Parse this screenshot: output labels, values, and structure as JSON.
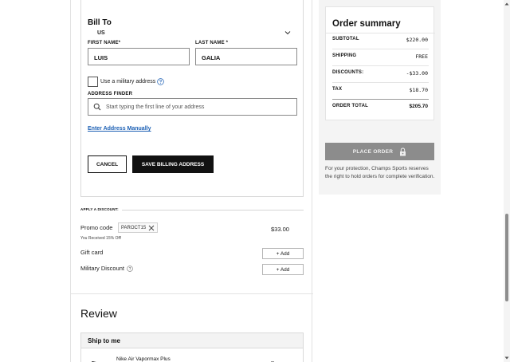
{
  "billing": {
    "title": "Bill To",
    "country": "US",
    "first_name_label": "FIRST NAME*",
    "first_name_value": "LUIS",
    "last_name_label": "LAST NAME *",
    "last_name_value": "GALIA",
    "military_checkbox_label": "Use a military address",
    "military_checked": false,
    "address_finder_label": "ADDRESS FINDER",
    "address_finder_placeholder": "Start typing the first line of your address",
    "enter_manually_link": "Enter Address Manually",
    "cancel_label": "CANCEL",
    "save_label": "SAVE BILLING ADDRESS"
  },
  "discounts": {
    "heading": "APPLY A DISCOUNT:",
    "promo_label": "Promo code",
    "promo_code": "PAROCT15",
    "promo_amount": "$33.00",
    "promo_received": "You Received 15% Off!",
    "gift_card_label": "Gift card",
    "gift_card_add": "+ Add",
    "military_discount_label": "Military Discount",
    "military_discount_add": "+ Add"
  },
  "review": {
    "title": "Review",
    "ship_header": "Ship to me",
    "product_name": "Nike Air Vapormax Plus"
  },
  "summary": {
    "title": "Order summary",
    "subtotal_label": "SUBTOTAL",
    "subtotal_value": "$220.00",
    "shipping_label": "SHIPPING",
    "shipping_value": "FREE",
    "discounts_label": "DISCOUNTS:",
    "discounts_value": "-$33.00",
    "tax_label": "TAX",
    "tax_value": "$18.70",
    "total_label": "ORDER TOTAL",
    "total_value": "$205.70",
    "place_order_label": "PLACE ORDER",
    "protection_note": "For your protection, Champs Sports reserves the right to hold orders for complete verification."
  },
  "icons": {
    "chevron": "chevron-down-icon",
    "help": "help-circle-icon",
    "search": "search-icon",
    "close": "close-icon",
    "lock": "lock-icon"
  },
  "colors": {
    "primary_button": "#111111",
    "link": "#1b5fb4",
    "disabled_button": "#8c8c8c",
    "summary_background": "#f4f4f4"
  }
}
